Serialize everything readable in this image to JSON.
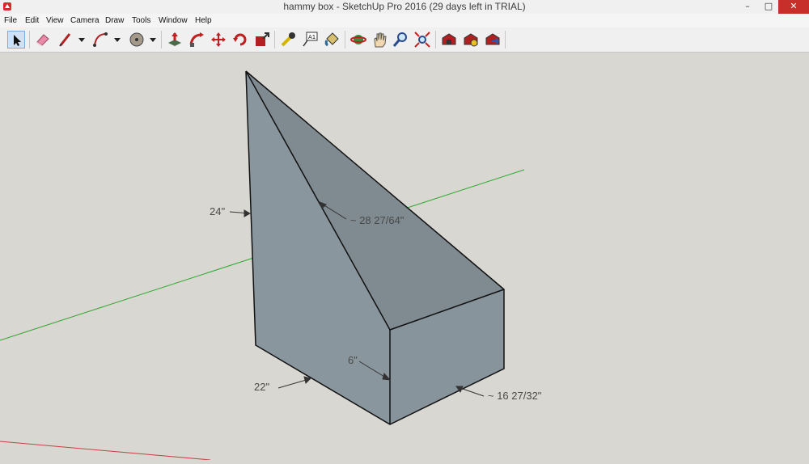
{
  "window": {
    "title": "hammy box - SketchUp Pro 2016 (29 days left in TRIAL)",
    "minimize": "–",
    "maximize": "□",
    "close": "✕"
  },
  "menu": {
    "items": [
      {
        "label": "File"
      },
      {
        "label": "Edit"
      },
      {
        "label": "View"
      },
      {
        "label": "Camera"
      },
      {
        "label": "Draw"
      },
      {
        "label": "Tools"
      },
      {
        "label": "Window"
      },
      {
        "label": "Help"
      }
    ]
  },
  "toolbar": {
    "tools": [
      "select-icon",
      "eraser-icon",
      "line-icon",
      "arc-icon",
      "shapes-icon",
      "push-pull-icon",
      "follow-me-icon",
      "move-icon",
      "rotate-icon",
      "scale-icon",
      "tape-measure-icon",
      "text-icon",
      "paint-bucket-icon",
      "orbit-icon",
      "pan-icon",
      "zoom-icon",
      "zoom-extents-icon",
      "warehouse-icon",
      "extension-warehouse-icon",
      "share-model-icon"
    ]
  },
  "model": {
    "dimensions": {
      "height": "24\"",
      "diagonal": "~ 28 27/64\"",
      "depth": "22\"",
      "front_height": "6\"",
      "width": "~ 16 27/32\""
    },
    "colors": {
      "face_front": "#8a969e",
      "face_slope": "#7f8a91",
      "face_side": "#87949c",
      "green_axis": "#2fa52f",
      "red_axis": "#c84040",
      "background": "#d8d7d1"
    }
  }
}
